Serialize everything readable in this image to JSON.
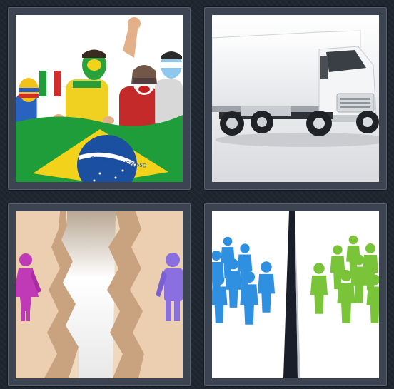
{
  "puzzle": {
    "tiles": [
      {
        "subject": "fans-with-flag",
        "flag_text": "ORDEM E PROGRESSO"
      },
      {
        "subject": "white-truck"
      },
      {
        "subject": "people-split-by-crack"
      },
      {
        "subject": "blue-green-groups-divided"
      }
    ]
  },
  "colors": {
    "frame": "#3b4450",
    "background": "#1f2630",
    "flag_green": "#1f9d3a",
    "flag_yellow": "#f2d21a",
    "flag_blue": "#1b4fa0",
    "crowd_blue": "#2f8fe0",
    "crowd_green": "#7ac43a",
    "figure_pink": "#c03ab8",
    "figure_purple": "#8a6fe0"
  }
}
